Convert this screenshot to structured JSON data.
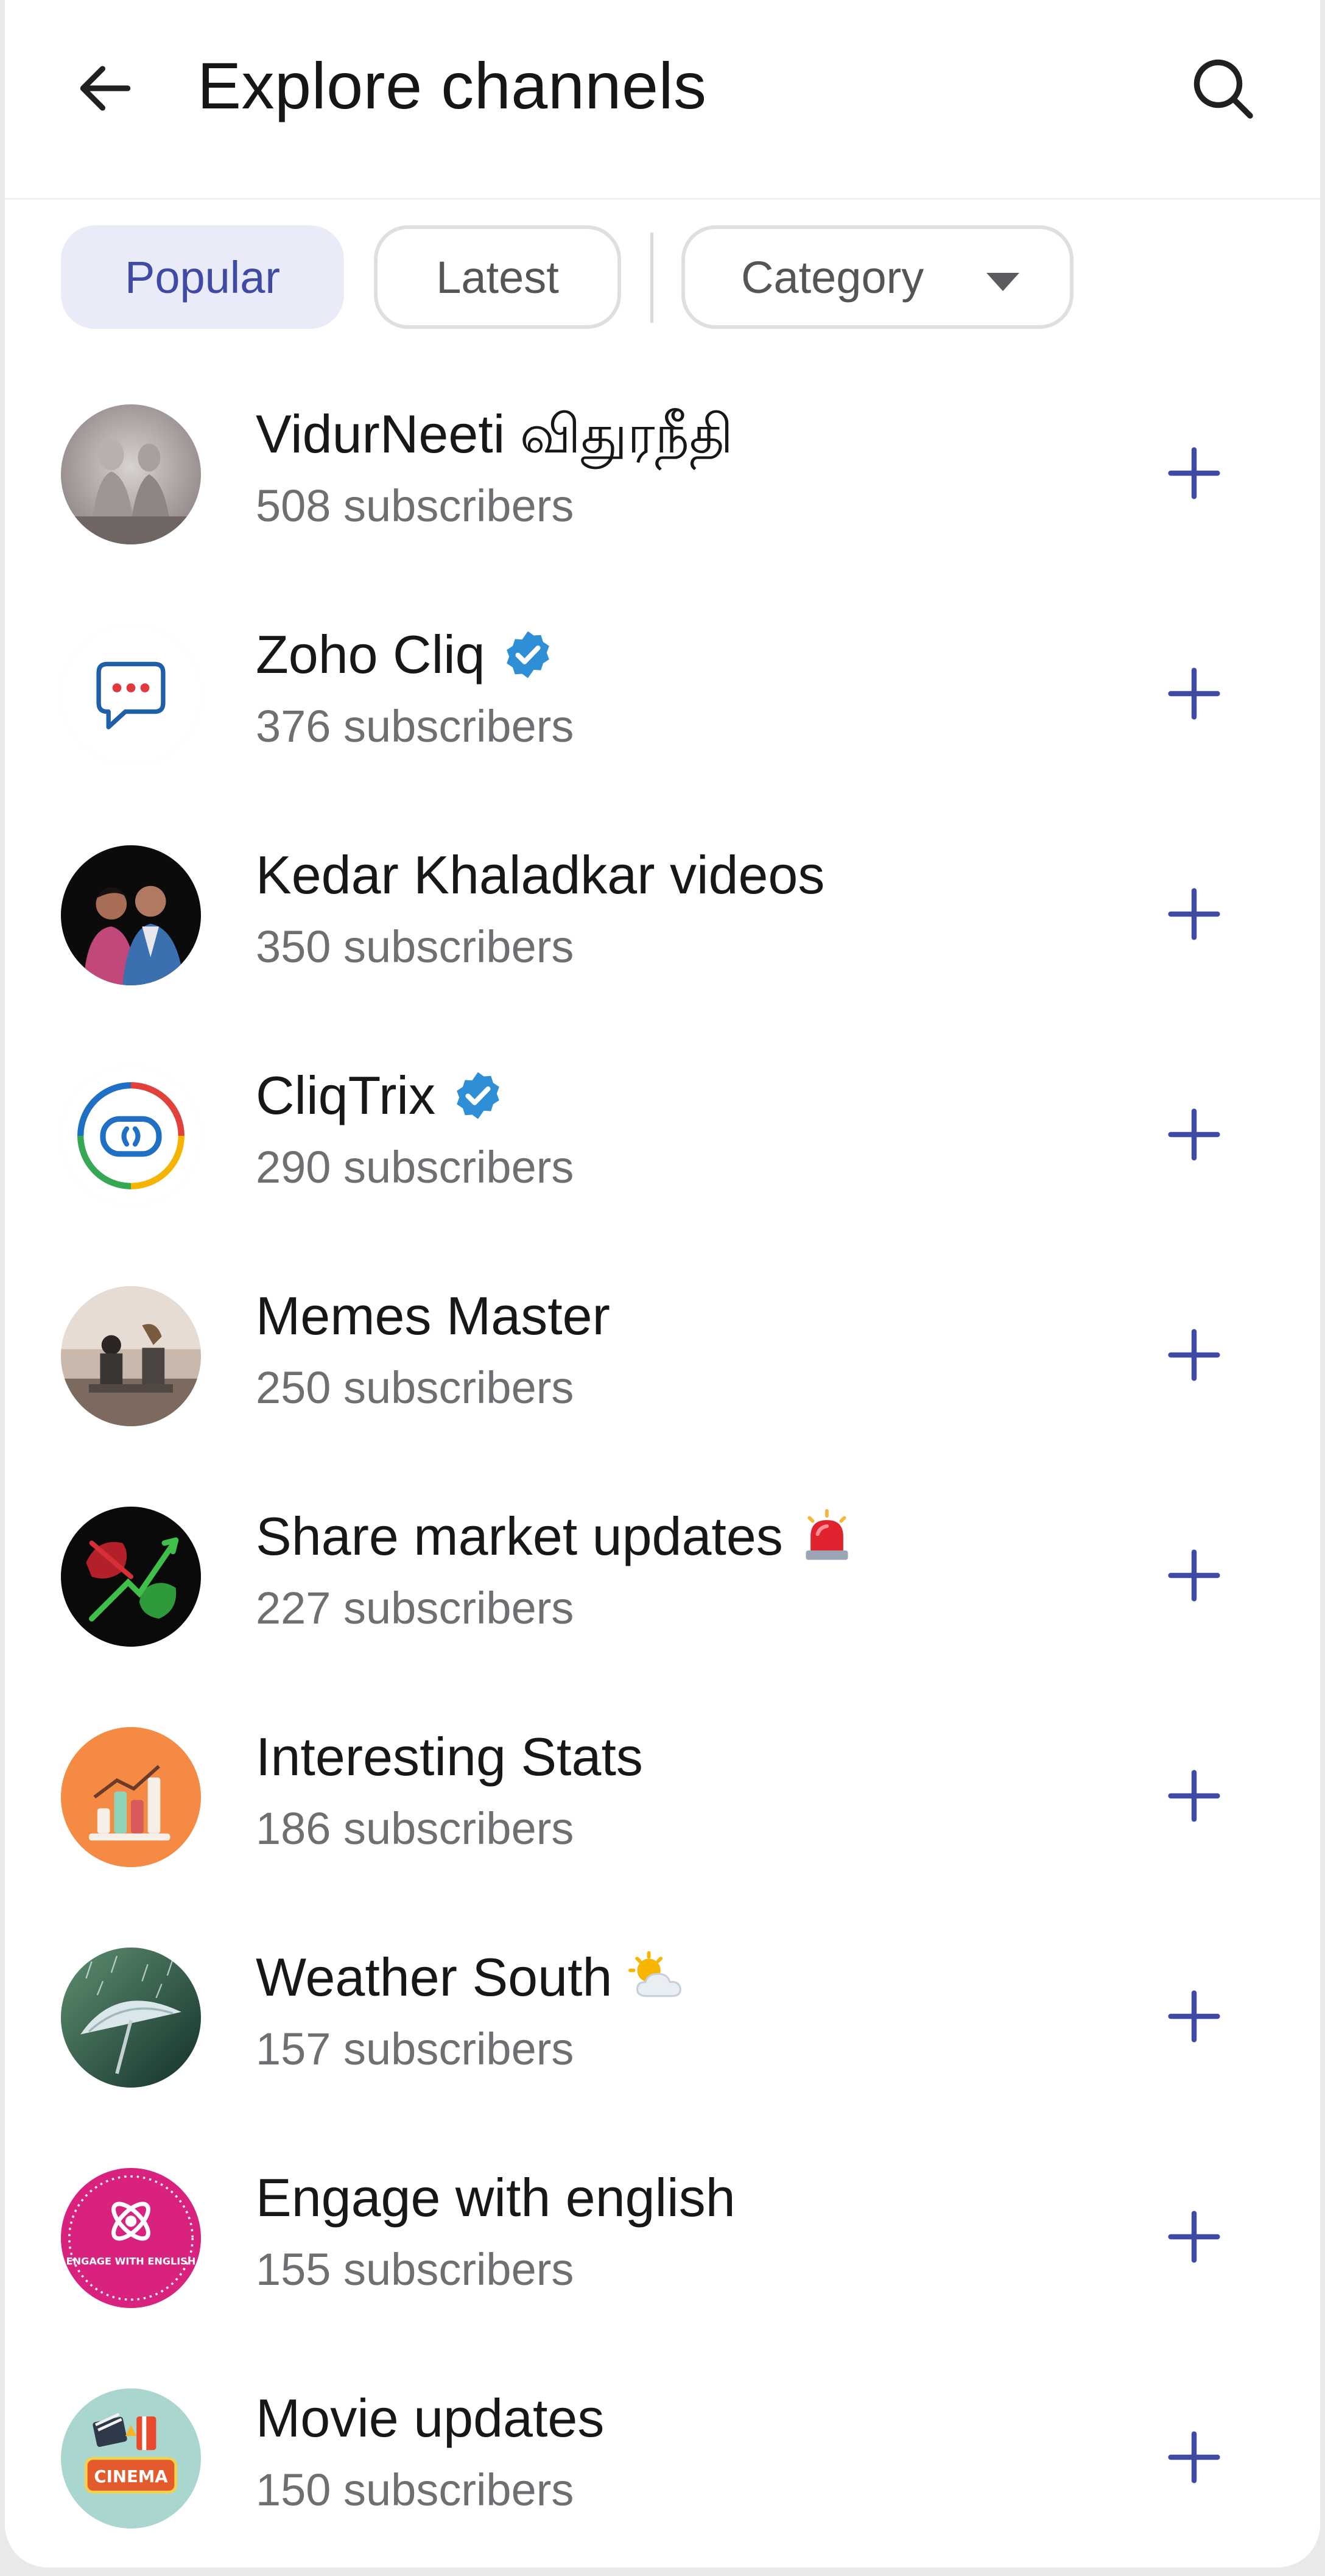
{
  "header": {
    "title": "Explore channels",
    "back_icon": "arrow-left-icon",
    "search_icon": "search-icon"
  },
  "filters": {
    "popular": "Popular",
    "latest": "Latest",
    "category": "Category",
    "active": "Popular"
  },
  "colors": {
    "accent": "#3f4aa4",
    "chip_active_bg": "#e9ebf8",
    "verified": "#2e8fd6"
  },
  "channels": [
    {
      "name": "VidurNeeti விதுரநீதி",
      "subscribers": "508 subscribers",
      "badge": "none",
      "avatar": "statue-avatar"
    },
    {
      "name": "Zoho Cliq",
      "subscribers": "376 subscribers",
      "badge": "verified-badge-icon",
      "avatar": "chat-bubble-avatar"
    },
    {
      "name": "Kedar Khaladkar videos",
      "subscribers": "350 subscribers",
      "badge": "none",
      "avatar": "couple-photo-avatar"
    },
    {
      "name": "CliqTrix",
      "subscribers": "290 subscribers",
      "badge": "verified-badge-icon",
      "avatar": "bot-logo-avatar"
    },
    {
      "name": "Memes Master",
      "subscribers": "250 subscribers",
      "badge": "none",
      "avatar": "meme-photo-avatar"
    },
    {
      "name": "Share market updates",
      "subscribers": "227 subscribers",
      "badge": "siren-emoji-icon",
      "avatar": "bull-bear-avatar"
    },
    {
      "name": "Interesting Stats",
      "subscribers": "186 subscribers",
      "badge": "none",
      "avatar": "bar-chart-avatar"
    },
    {
      "name": "Weather South",
      "subscribers": "157 subscribers",
      "badge": "sun-cloud-emoji-icon",
      "avatar": "umbrella-rain-avatar"
    },
    {
      "name": "Engage with english",
      "subscribers": "155 subscribers",
      "badge": "none",
      "avatar": "engage-logo-avatar",
      "avatar_text": "ENGAGE WITH ENGLISH"
    },
    {
      "name": "Movie updates",
      "subscribers": "150 subscribers",
      "badge": "none",
      "avatar": "cinema-logo-avatar",
      "avatar_text": "CINEMA"
    }
  ]
}
